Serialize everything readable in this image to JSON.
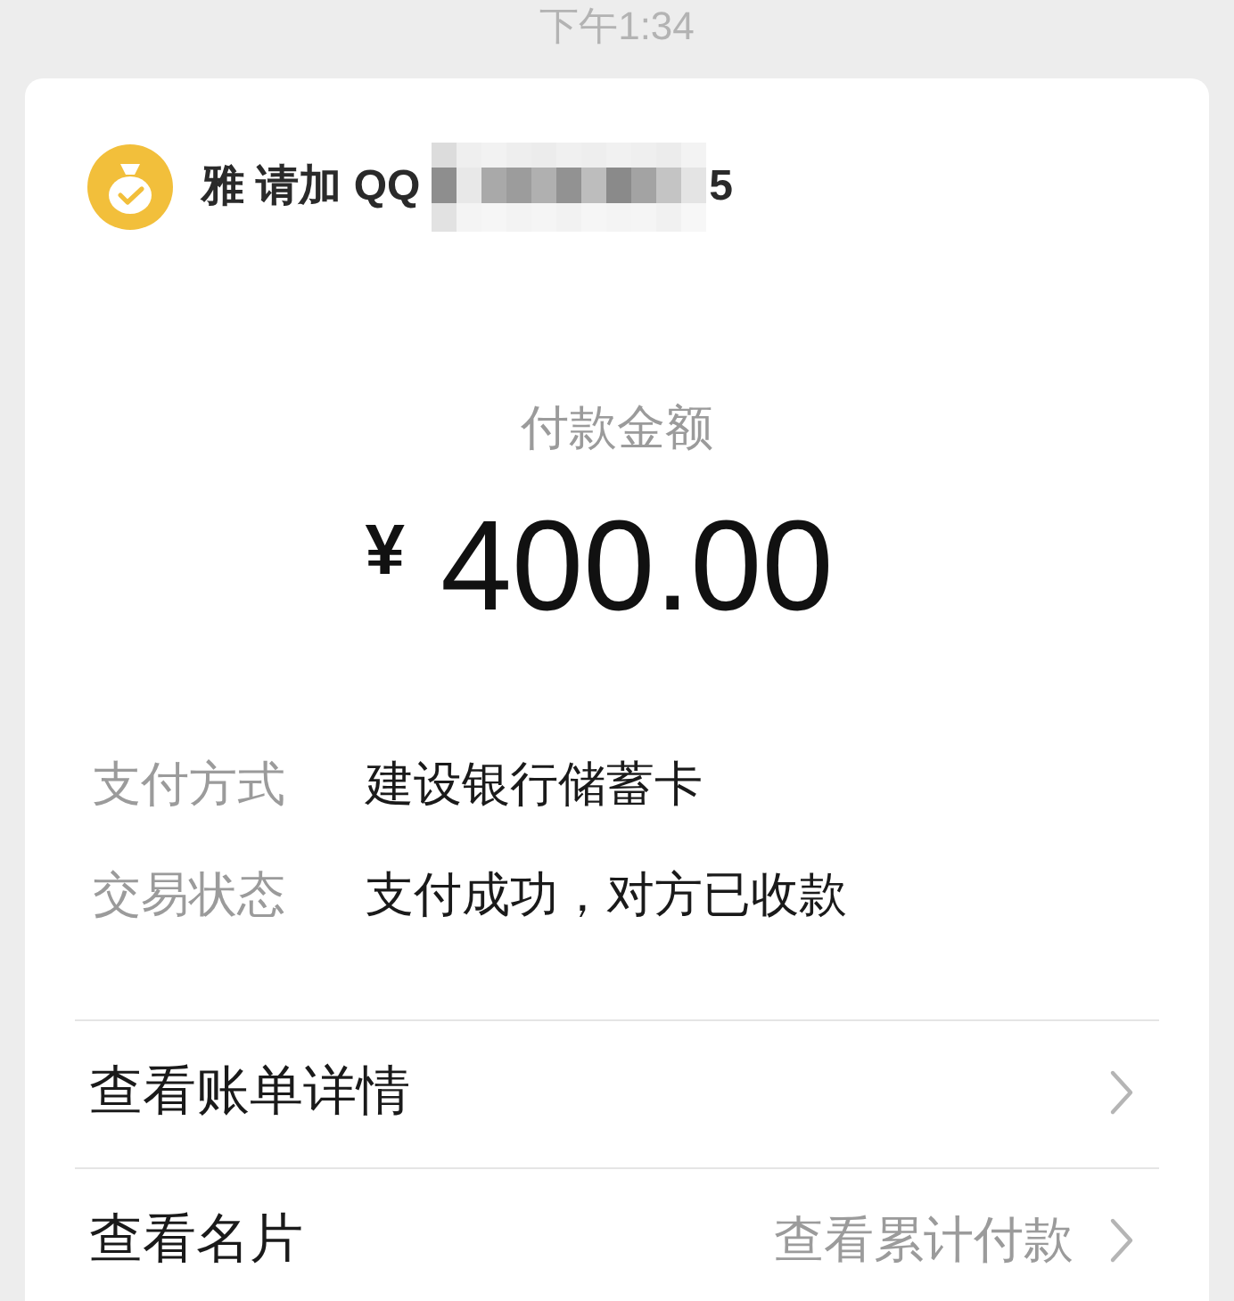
{
  "status_bar": {
    "time": "下午1:34"
  },
  "payee": {
    "name": "雅 请加 QQ",
    "redacted": true,
    "name_tail": "5"
  },
  "amount": {
    "label": "付款金额",
    "currency": "¥",
    "value": "400.00"
  },
  "details": [
    {
      "label": "支付方式",
      "value": "建设银行储蓄卡"
    },
    {
      "label": "交易状态",
      "value": "支付成功，对方已收款"
    }
  ],
  "links": [
    {
      "label": "查看账单详情"
    },
    {
      "label": "查看名片",
      "value": "查看累计付款"
    }
  ]
}
